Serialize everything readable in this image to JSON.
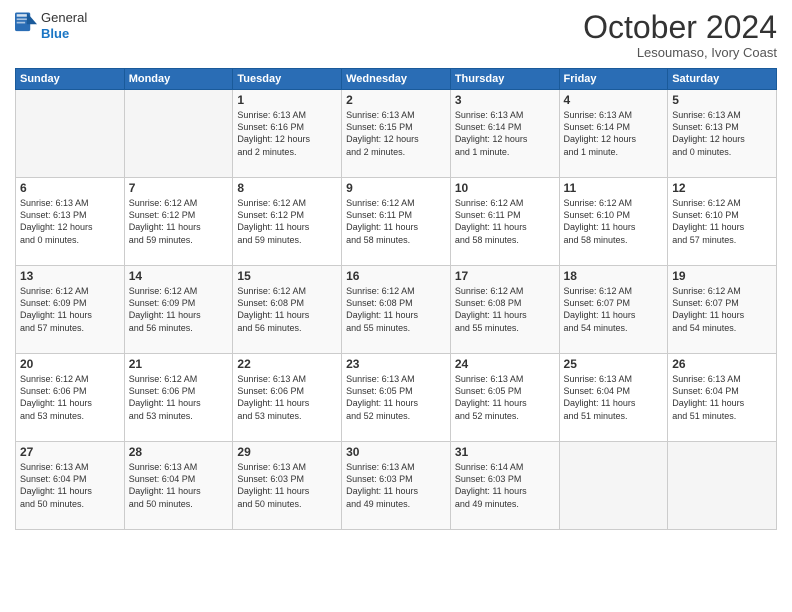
{
  "header": {
    "logo": {
      "line1": "General",
      "line2": "Blue"
    },
    "title": "October 2024",
    "location": "Lesoumaso, Ivory Coast"
  },
  "weekdays": [
    "Sunday",
    "Monday",
    "Tuesday",
    "Wednesday",
    "Thursday",
    "Friday",
    "Saturday"
  ],
  "weeks": [
    [
      {
        "day": "",
        "info": ""
      },
      {
        "day": "",
        "info": ""
      },
      {
        "day": "1",
        "info": "Sunrise: 6:13 AM\nSunset: 6:16 PM\nDaylight: 12 hours\nand 2 minutes."
      },
      {
        "day": "2",
        "info": "Sunrise: 6:13 AM\nSunset: 6:15 PM\nDaylight: 12 hours\nand 2 minutes."
      },
      {
        "day": "3",
        "info": "Sunrise: 6:13 AM\nSunset: 6:14 PM\nDaylight: 12 hours\nand 1 minute."
      },
      {
        "day": "4",
        "info": "Sunrise: 6:13 AM\nSunset: 6:14 PM\nDaylight: 12 hours\nand 1 minute."
      },
      {
        "day": "5",
        "info": "Sunrise: 6:13 AM\nSunset: 6:13 PM\nDaylight: 12 hours\nand 0 minutes."
      }
    ],
    [
      {
        "day": "6",
        "info": "Sunrise: 6:13 AM\nSunset: 6:13 PM\nDaylight: 12 hours\nand 0 minutes."
      },
      {
        "day": "7",
        "info": "Sunrise: 6:12 AM\nSunset: 6:12 PM\nDaylight: 11 hours\nand 59 minutes."
      },
      {
        "day": "8",
        "info": "Sunrise: 6:12 AM\nSunset: 6:12 PM\nDaylight: 11 hours\nand 59 minutes."
      },
      {
        "day": "9",
        "info": "Sunrise: 6:12 AM\nSunset: 6:11 PM\nDaylight: 11 hours\nand 58 minutes."
      },
      {
        "day": "10",
        "info": "Sunrise: 6:12 AM\nSunset: 6:11 PM\nDaylight: 11 hours\nand 58 minutes."
      },
      {
        "day": "11",
        "info": "Sunrise: 6:12 AM\nSunset: 6:10 PM\nDaylight: 11 hours\nand 58 minutes."
      },
      {
        "day": "12",
        "info": "Sunrise: 6:12 AM\nSunset: 6:10 PM\nDaylight: 11 hours\nand 57 minutes."
      }
    ],
    [
      {
        "day": "13",
        "info": "Sunrise: 6:12 AM\nSunset: 6:09 PM\nDaylight: 11 hours\nand 57 minutes."
      },
      {
        "day": "14",
        "info": "Sunrise: 6:12 AM\nSunset: 6:09 PM\nDaylight: 11 hours\nand 56 minutes."
      },
      {
        "day": "15",
        "info": "Sunrise: 6:12 AM\nSunset: 6:08 PM\nDaylight: 11 hours\nand 56 minutes."
      },
      {
        "day": "16",
        "info": "Sunrise: 6:12 AM\nSunset: 6:08 PM\nDaylight: 11 hours\nand 55 minutes."
      },
      {
        "day": "17",
        "info": "Sunrise: 6:12 AM\nSunset: 6:08 PM\nDaylight: 11 hours\nand 55 minutes."
      },
      {
        "day": "18",
        "info": "Sunrise: 6:12 AM\nSunset: 6:07 PM\nDaylight: 11 hours\nand 54 minutes."
      },
      {
        "day": "19",
        "info": "Sunrise: 6:12 AM\nSunset: 6:07 PM\nDaylight: 11 hours\nand 54 minutes."
      }
    ],
    [
      {
        "day": "20",
        "info": "Sunrise: 6:12 AM\nSunset: 6:06 PM\nDaylight: 11 hours\nand 53 minutes."
      },
      {
        "day": "21",
        "info": "Sunrise: 6:12 AM\nSunset: 6:06 PM\nDaylight: 11 hours\nand 53 minutes."
      },
      {
        "day": "22",
        "info": "Sunrise: 6:13 AM\nSunset: 6:06 PM\nDaylight: 11 hours\nand 53 minutes."
      },
      {
        "day": "23",
        "info": "Sunrise: 6:13 AM\nSunset: 6:05 PM\nDaylight: 11 hours\nand 52 minutes."
      },
      {
        "day": "24",
        "info": "Sunrise: 6:13 AM\nSunset: 6:05 PM\nDaylight: 11 hours\nand 52 minutes."
      },
      {
        "day": "25",
        "info": "Sunrise: 6:13 AM\nSunset: 6:04 PM\nDaylight: 11 hours\nand 51 minutes."
      },
      {
        "day": "26",
        "info": "Sunrise: 6:13 AM\nSunset: 6:04 PM\nDaylight: 11 hours\nand 51 minutes."
      }
    ],
    [
      {
        "day": "27",
        "info": "Sunrise: 6:13 AM\nSunset: 6:04 PM\nDaylight: 11 hours\nand 50 minutes."
      },
      {
        "day": "28",
        "info": "Sunrise: 6:13 AM\nSunset: 6:04 PM\nDaylight: 11 hours\nand 50 minutes."
      },
      {
        "day": "29",
        "info": "Sunrise: 6:13 AM\nSunset: 6:03 PM\nDaylight: 11 hours\nand 50 minutes."
      },
      {
        "day": "30",
        "info": "Sunrise: 6:13 AM\nSunset: 6:03 PM\nDaylight: 11 hours\nand 49 minutes."
      },
      {
        "day": "31",
        "info": "Sunrise: 6:14 AM\nSunset: 6:03 PM\nDaylight: 11 hours\nand 49 minutes."
      },
      {
        "day": "",
        "info": ""
      },
      {
        "day": "",
        "info": ""
      }
    ]
  ]
}
